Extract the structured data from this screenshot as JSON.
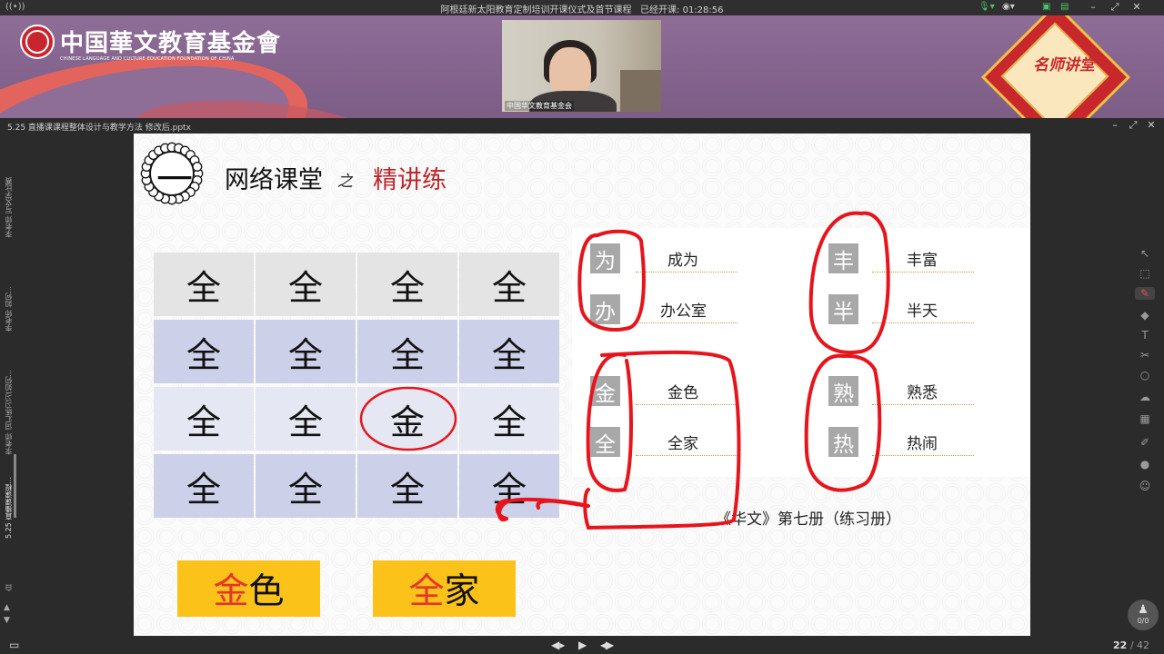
{
  "window": {
    "title": "阿根廷新太阳教育定制培训开课仪式及首节课程",
    "elapsed_label": "已经开课: 01:28:56"
  },
  "banner": {
    "org_cn": "中国華文教育基金會",
    "org_en": "CHINESE LANGUAGE AND CULTURE EDUCATION FOUNDATION OF CHINA",
    "video_caption": "中国华文教育基金会",
    "badge_text": "名师讲堂"
  },
  "document": {
    "filename": "5.25 直播课课程整体设计与教学方法 修改后.pptx"
  },
  "left_rail": {
    "items": [
      {
        "label": "李老师 写文学比赛"
      },
      {
        "label": "李老师 如何..."
      },
      {
        "label": "李老师 词汇练习习(如何..."
      },
      {
        "label": "5.25 直播课课程..."
      },
      {
        "label": "白"
      }
    ]
  },
  "slide": {
    "number": "一",
    "heading": "网络课堂",
    "heading_connector": "之",
    "heading_highlight": "精讲练",
    "grid": [
      [
        "全",
        "全",
        "全",
        "全"
      ],
      [
        "全",
        "全",
        "全",
        "全"
      ],
      [
        "全",
        "全",
        "金",
        "全"
      ],
      [
        "全",
        "全",
        "全",
        "全"
      ]
    ],
    "pairs": [
      {
        "char": "为",
        "word": "成为"
      },
      {
        "char": "办",
        "word": "办公室"
      },
      {
        "char": "丰",
        "word": "丰富"
      },
      {
        "char": "半",
        "word": "半天"
      },
      {
        "char": "金",
        "word": "金色"
      },
      {
        "char": "全",
        "word": "全家"
      },
      {
        "char": "熟",
        "word": "熟悉"
      },
      {
        "char": "热",
        "word": "热闹"
      }
    ],
    "caption": "《华文》第七册（练习册）",
    "yellow_boxes": [
      {
        "red": "金",
        "rest": "色"
      },
      {
        "red": "全",
        "rest": "家"
      }
    ]
  },
  "footer": {
    "page": "22",
    "total": "/ 42",
    "user_count": "0/0"
  },
  "colors": {
    "banner": "#8e6d97",
    "accent_red": "#c0262b",
    "annotation_red": "#e8141c",
    "highlight_yellow": "#fbc21a"
  }
}
